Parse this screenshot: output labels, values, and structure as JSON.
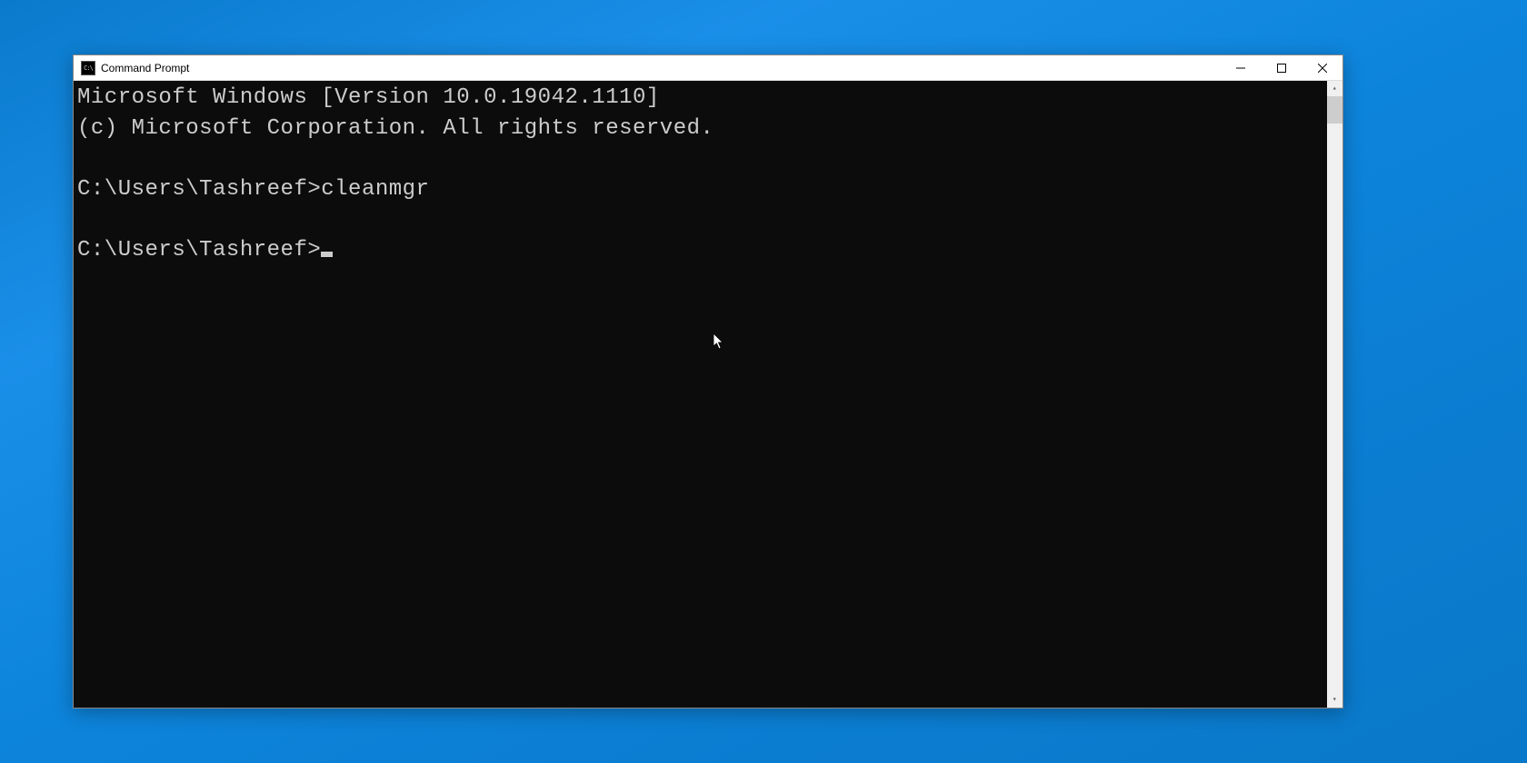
{
  "window": {
    "title": "Command Prompt",
    "icon_label": "C:\\"
  },
  "terminal": {
    "lines": [
      "Microsoft Windows [Version 10.0.19042.1110]",
      "(c) Microsoft Corporation. All rights reserved.",
      "",
      "C:\\Users\\Tashreef>cleanmgr",
      "",
      "C:\\Users\\Tashreef>"
    ]
  }
}
